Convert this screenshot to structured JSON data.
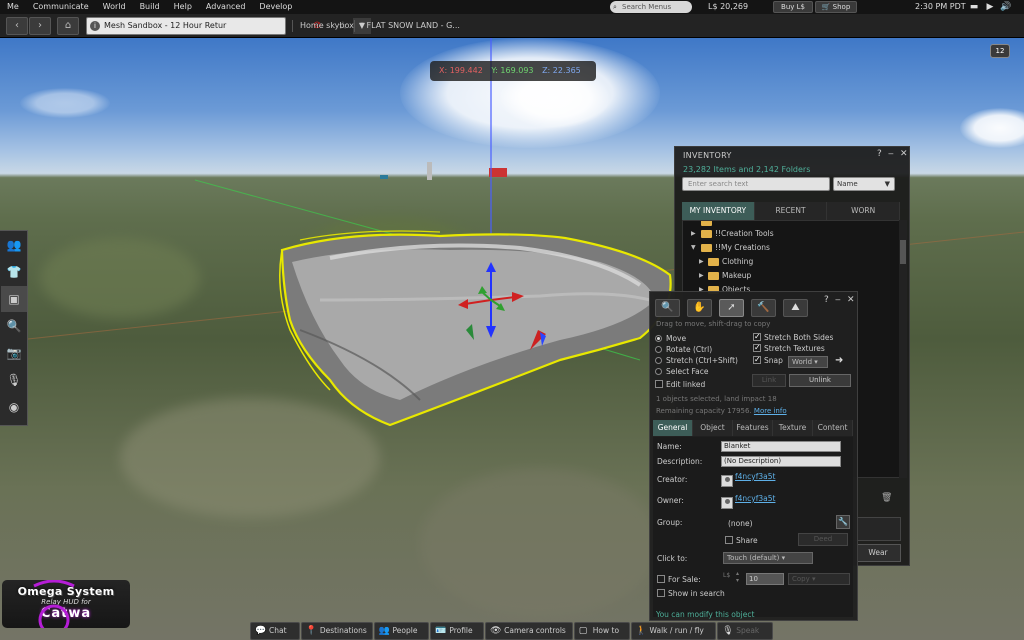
{
  "menubar": {
    "items": [
      "Me",
      "Communicate",
      "World",
      "Build",
      "Help",
      "Advanced",
      "Develop"
    ],
    "search_placeholder": "Search Menus",
    "balance": "L$ 20,269",
    "buy_label": "Buy L$",
    "shop_label": "Shop",
    "clock": "2:30 PM PDT"
  },
  "navbar": {
    "location": "Mesh Sandbox - 12 Hour Retur",
    "favorites": [
      "Home skybox",
      "* FLAT SNOW LAND - G..."
    ]
  },
  "scene": {
    "coords": {
      "x": "X: 199.442",
      "y": "Y: 169.093",
      "z": "Z: 22.365"
    },
    "badge": "12",
    "selection_outline_color": "#e8e800",
    "sky_color": "#3f78c7",
    "ground_color": "#55633f"
  },
  "left_toolbar": {
    "buttons": [
      {
        "icon": "people-icon",
        "glyph": "👥"
      },
      {
        "icon": "shirt-icon",
        "glyph": "👕"
      },
      {
        "icon": "inventory-icon",
        "glyph": "▣"
      },
      {
        "icon": "search-icon",
        "glyph": "🔍"
      },
      {
        "icon": "snapshot-icon",
        "glyph": "📷"
      },
      {
        "icon": "voice-icon",
        "glyph": "🎙"
      },
      {
        "icon": "sound-icon",
        "glyph": "◉"
      }
    ]
  },
  "hud": {
    "line1": "Omega System",
    "line2": "Relay HUD for",
    "line3": "Catwa"
  },
  "bottombar": {
    "buttons": [
      {
        "icon": "chat-icon",
        "glyph": "💬",
        "label": "Chat"
      },
      {
        "icon": "destinations-icon",
        "glyph": "📍",
        "label": "Destinations"
      },
      {
        "icon": "people-icon",
        "glyph": "👥",
        "label": "People"
      },
      {
        "icon": "profile-icon",
        "glyph": "🪪",
        "label": "Profile"
      },
      {
        "icon": "camera-icon",
        "glyph": "👁",
        "label": "Camera controls"
      },
      {
        "icon": "howto-icon",
        "glyph": "▢",
        "label": "How to"
      },
      {
        "icon": "walk-icon",
        "glyph": "🚶",
        "label": "Walk / run / fly"
      },
      {
        "icon": "speak-icon",
        "glyph": "🎙",
        "label": "Speak"
      }
    ]
  },
  "inventory": {
    "title": "INVENTORY",
    "count": "23,282 Items and 2,142 Folders",
    "search_placeholder": "Enter search text",
    "sort": "Name",
    "tabs": [
      "MY INVENTORY",
      "RECENT",
      "WORN"
    ],
    "tree": [
      {
        "indent": 1,
        "expanded": false,
        "label": "!!Creation Tools"
      },
      {
        "indent": 1,
        "expanded": true,
        "label": "!!My Creations"
      },
      {
        "indent": 2,
        "expanded": false,
        "label": "Clothing"
      },
      {
        "indent": 2,
        "expanded": false,
        "label": "Makeup"
      },
      {
        "indent": 2,
        "expanded": false,
        "label": "Objects"
      }
    ],
    "wear_label": "Wear"
  },
  "buildtool": {
    "hint": "Drag to move, shift-drag to copy",
    "modes": [
      "Move",
      "Rotate (Ctrl)",
      "Stretch (Ctrl+Shift)",
      "Select Face"
    ],
    "edit_linked": "Edit linked",
    "stretch_both": "Stretch Both Sides",
    "stretch_textures": "Stretch Textures",
    "snap": "Snap",
    "snap_mode": "World",
    "link_label": "Link",
    "unlink_label": "Unlink",
    "objects_selected": "1 objects selected, land impact 18",
    "remaining": "Remaining capacity 17956.",
    "more_info": "More info",
    "tabs": [
      "General",
      "Object",
      "Features",
      "Texture",
      "Content"
    ],
    "general": {
      "name_label": "Name:",
      "name_value": "Blanket",
      "desc_label": "Description:",
      "desc_value": "(No Description)",
      "creator_label": "Creator:",
      "creator_value": "f4ncyf3a5t",
      "owner_label": "Owner:",
      "owner_value": "f4ncyf3a5t",
      "group_label": "Group:",
      "group_value": "(none)",
      "share_label": "Share",
      "deed_label": "Deed",
      "clickto_label": "Click to:",
      "clickto_value": "Touch  (default)",
      "forsale_label": "For Sale:",
      "currency": "L$",
      "price": "10",
      "copy_value": "Copy",
      "showsearch_label": "Show in search"
    },
    "footer": "You can modify this object"
  }
}
